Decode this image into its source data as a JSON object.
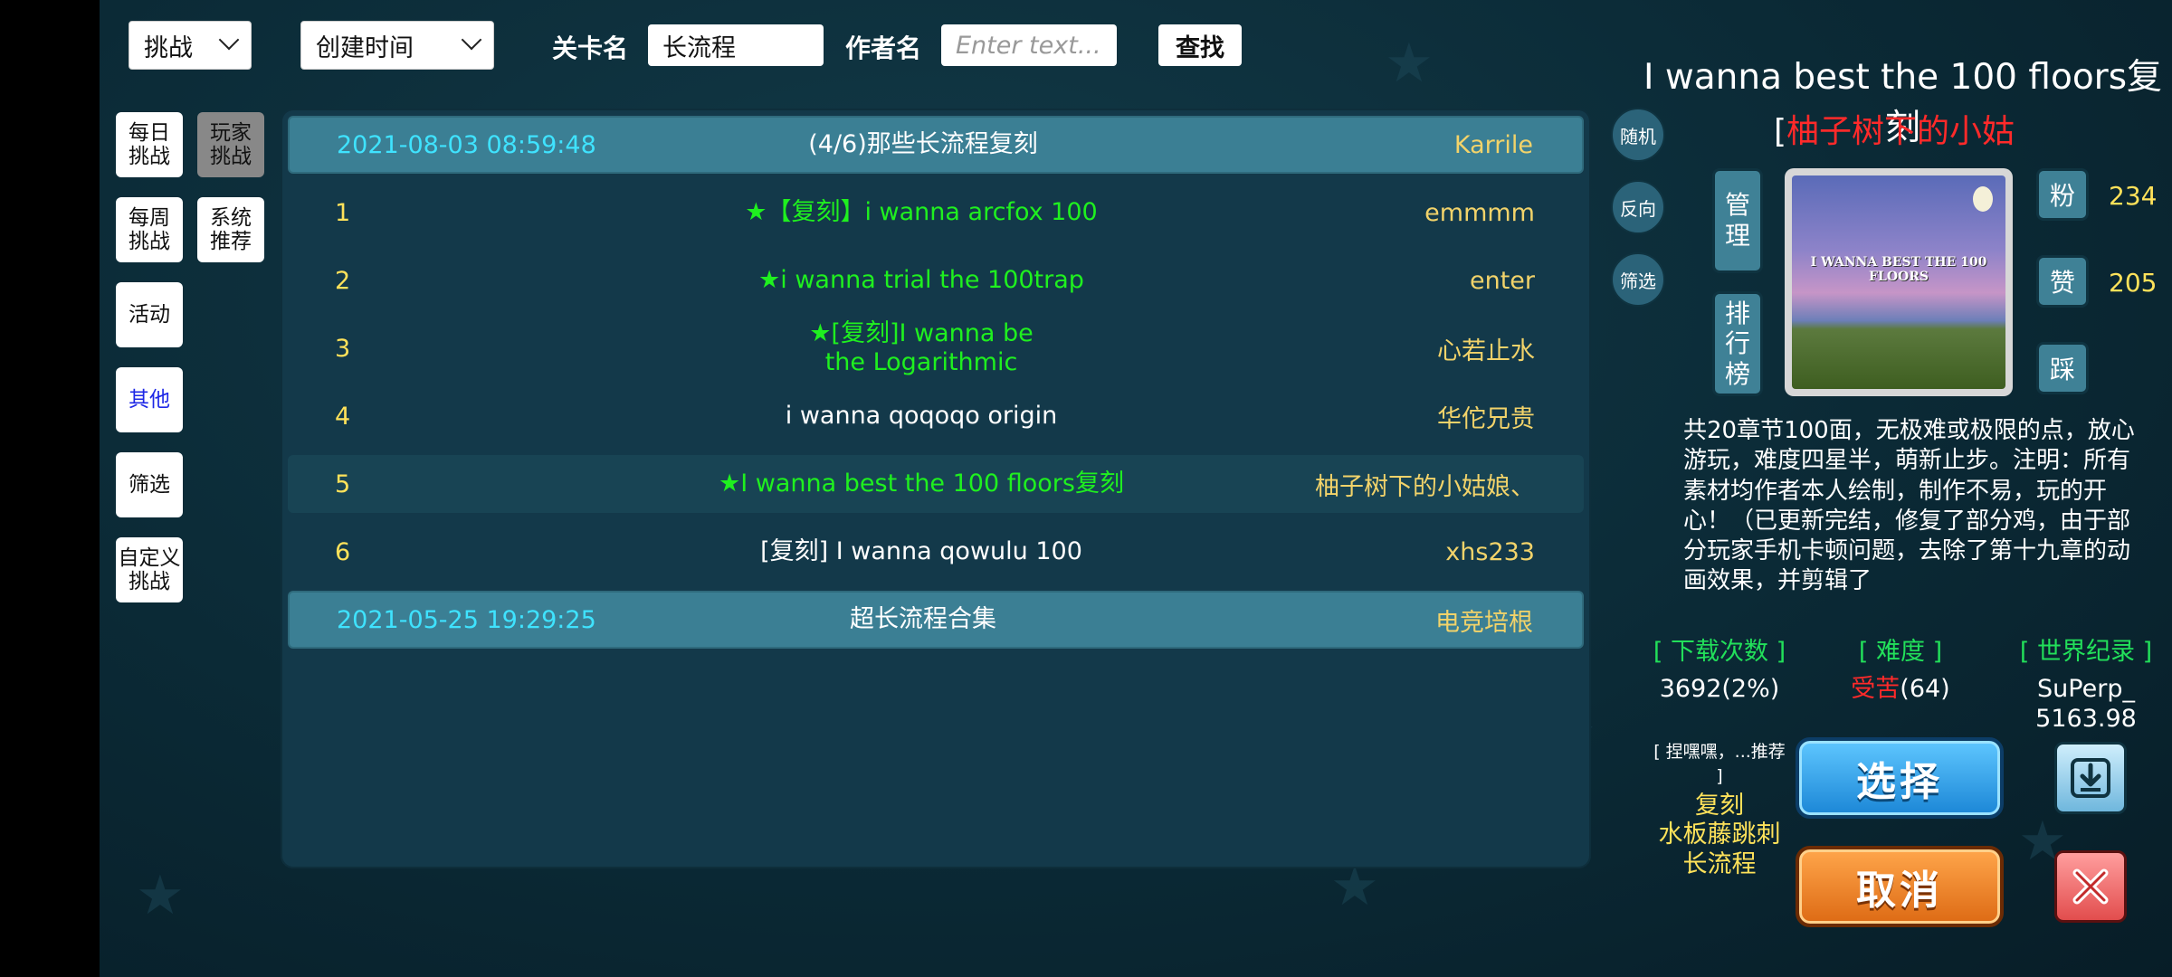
{
  "filters": {
    "mode_select": "挑战",
    "sort_select": "创建时间",
    "level_name_label": "关卡名",
    "level_name_value": "长流程",
    "author_label": "作者名",
    "author_placeholder": "Enter text...",
    "search_button": "查找"
  },
  "sidebar": {
    "items": [
      {
        "label": "每日\n挑战"
      },
      {
        "label": "玩家\n挑战"
      },
      {
        "label": "每周\n挑战"
      },
      {
        "label": "系统\n推荐"
      },
      {
        "label": "活动"
      },
      {
        "label": "其他"
      },
      {
        "label": "筛选"
      },
      {
        "label": "自定义\n挑战"
      }
    ]
  },
  "list": {
    "header1": {
      "date": "2021-08-03 08:59:48",
      "title": "(4/6)那些长流程复刻",
      "author": "Karrile"
    },
    "rows": [
      {
        "index": "1",
        "title": "★【复刻】i wanna arcfox 100",
        "author": "emmmm"
      },
      {
        "index": "2",
        "title": "★i wanna trial the 100trap",
        "author": "enter"
      },
      {
        "index": "3",
        "title": "★[复刻]I wanna be the Logarithmic",
        "author": "心若止水"
      },
      {
        "index": "4",
        "title": "i wanna qoqoqo origin",
        "author": "华佗兄贵"
      },
      {
        "index": "5",
        "title": "★I wanna best the 100 floors复刻",
        "author": "柚子树下的小姑娘、"
      },
      {
        "index": "6",
        "title": "[复刻] I wanna qowulu 100",
        "author": "xhs233"
      }
    ],
    "header2": {
      "date": "2021-05-25 19:29:25",
      "title": "超长流程合集",
      "author": "电竞培根"
    }
  },
  "side_actions": {
    "random": "随机",
    "reverse": "反向",
    "filter": "筛选"
  },
  "detail": {
    "title": "I wanna best the 100 floors复刻",
    "author_bracket": "[",
    "author": "柚子树下的小姑",
    "manage": "管\n理",
    "ranking": "排\n行\n榜",
    "fans_label": "粉",
    "fans": "234",
    "like_label": "赞",
    "likes": "205",
    "dislike_label": "踩",
    "cover_text": "I WANNA BEST THE 100 FLOORS",
    "description": "共20章节100面，无极难或极限的点，放心游玩，难度四星半，萌新止步。注明：所有素材均作者本人绘制，制作不易，玩的开心！（已更新完结，修复了部分鸡，由于部分玩家手机卡顿问题，去除了第十九章的动画效果，并剪辑了",
    "downloads_label": "[ 下载次数 ]",
    "downloads": "3692(2%)",
    "difficulty_label": "[ 难度 ]",
    "difficulty_word": "受苦",
    "difficulty_num": "(64)",
    "record_label": "[ 世界纪录 ]",
    "record_holder": "SuPerp_",
    "record_time": "5163.98",
    "recommend": "[ 捏嘿嘿，...推荐 ]",
    "tags": [
      "复刻",
      "水板藤跳刺",
      "长流程"
    ],
    "select_button": "选择",
    "cancel_button": "取消"
  },
  "colors": {
    "accent_green": "#1ff01f",
    "header_row": "#3b7f94",
    "panel": "#13394a",
    "date_cyan": "#3fe3ff",
    "author_gold": "#f2d36a"
  }
}
